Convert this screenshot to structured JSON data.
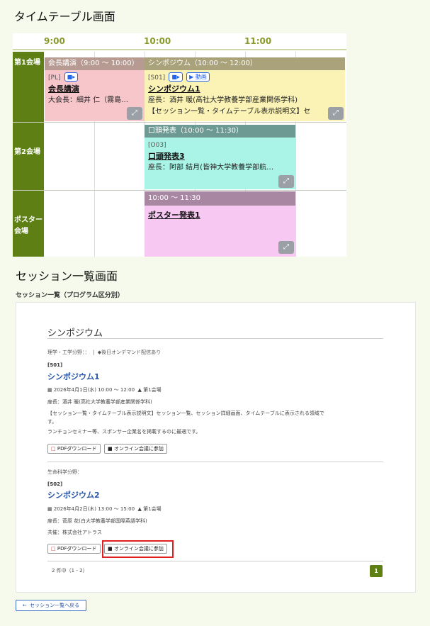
{
  "headings": {
    "timetable": "タイムテーブル画面",
    "session_list": "セッション一覧画面"
  },
  "timetable": {
    "times": [
      "9:00",
      "10:00",
      "11:00"
    ],
    "rooms": [
      "第1会場",
      "第2会場",
      "ポスター会場"
    ],
    "blocks": {
      "plenary": {
        "header": "会長講演（9:00 〜 10:00）",
        "code": "[PL]",
        "title": "会長講演",
        "person": "大会長：細井 仁（霧島…",
        "color": "#f7c6cb",
        "header_color": "#b79a91"
      },
      "symposium": {
        "header": "シンポジウム（10:00 〜 12:00）",
        "code": "[S01]",
        "video_label": "動画",
        "title": "シンポジウム1",
        "chair": "座長：酒井 暖(高社大学教養学部産業関係学科)",
        "note": "【セッション一覧・タイムテーブル表示説明文】セ",
        "color": "#faf3b5",
        "header_color": "#a9a27a"
      },
      "oral": {
        "header": "口頭発表（10:00 〜 11:30）",
        "code": "[O03]",
        "title": "口頭発表3",
        "chair": "座長：阿部 結月(皆神大学教養学部航…",
        "color": "#a9f4e6",
        "header_color": "#6d9a92"
      },
      "poster": {
        "header": "10:00 〜 11:30",
        "title": "ポスター発表1",
        "color": "#f7c9f2",
        "header_color": "#a887a3"
      }
    }
  },
  "session_list": {
    "breadcrumb": "セッション一覧（プログラム区分別）",
    "section_title": "シンポジウム",
    "sessions": [
      {
        "field": "理学・工学分野：：",
        "badge": "後日オンデマンド配信あり",
        "code": "[S01]",
        "name": "シンポジウム1",
        "date": "2026年4月1日(水) 10:00 〜 12:00",
        "venue": "第1会場",
        "chair": "座長：酒井 暖(高社大学教養学部産業関係学科)",
        "desc1": "【セッション一覧・タイムテーブル表示説明文】セッション一覧、セッション詳細画面、タイムテーブルに表示される領域で",
        "desc2": "す。",
        "desc3": "ランチョンセミナー等、スポンサー企業名を掲載するのに最適です。",
        "pdf_label": "PDFダウンロード",
        "online_label": "オンライン会議に参加"
      },
      {
        "field": "生命科学分野：",
        "code": "[S02]",
        "name": "シンポジウム2",
        "date": "2026年4月2日(木) 13:00 〜 15:00",
        "venue": "第1会場",
        "chair": "座長：菅原 花(白大学教養学部国際英語学科)",
        "cosponsor": "共催：株式会社アトラス",
        "pdf_label": "PDFダウンロード",
        "online_label": "オンライン会議に参加"
      }
    ],
    "count_text": "2 件中（1 - 2）",
    "page": "1",
    "back_label": "セッション一覧へ戻る"
  },
  "colors": {
    "room_column": "#5d7f14",
    "highlight": "#e02020",
    "link": "#2b56a8"
  }
}
